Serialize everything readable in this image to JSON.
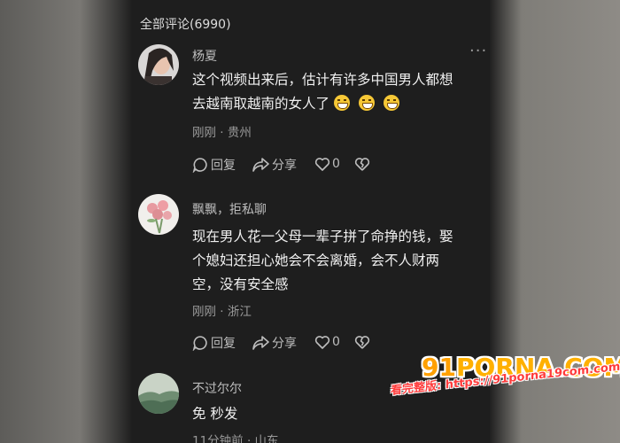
{
  "header": {
    "title": "全部评论(6990)",
    "more_icon": "more-icon"
  },
  "comments": [
    {
      "name": "杨夏",
      "text_line1": "这个视频出来后，估计有许多中国男人都想",
      "text_line2": "去越南取越南的女人了",
      "meta": "刚刚 · 贵州",
      "reply": "回复",
      "share": "分享",
      "likes": "0"
    },
    {
      "name": "飘飘，拒私聊",
      "text_line1": "现在男人花一父母一辈子拼了命挣的钱，娶",
      "text_line2": "个媳妇还担心她会不会离婚，会不人财两",
      "text_line3": "空，没有安全感",
      "meta": "刚刚 · 浙江",
      "reply": "回复",
      "share": "分享",
      "likes": "0"
    },
    {
      "name": "不过尔尔",
      "text_line1": "免 秒发",
      "meta": "11分钟前 · 山东"
    }
  ],
  "watermark": {
    "logo_prefix": "91",
    "logo_main": "PORNA.COM",
    "url": "看完整版: https://91porna19com.com"
  },
  "colors": {
    "panel": "#1e1e1e",
    "text": "#f0f0f0",
    "muted": "#9a9a9a",
    "emoji": "#f6c836"
  }
}
